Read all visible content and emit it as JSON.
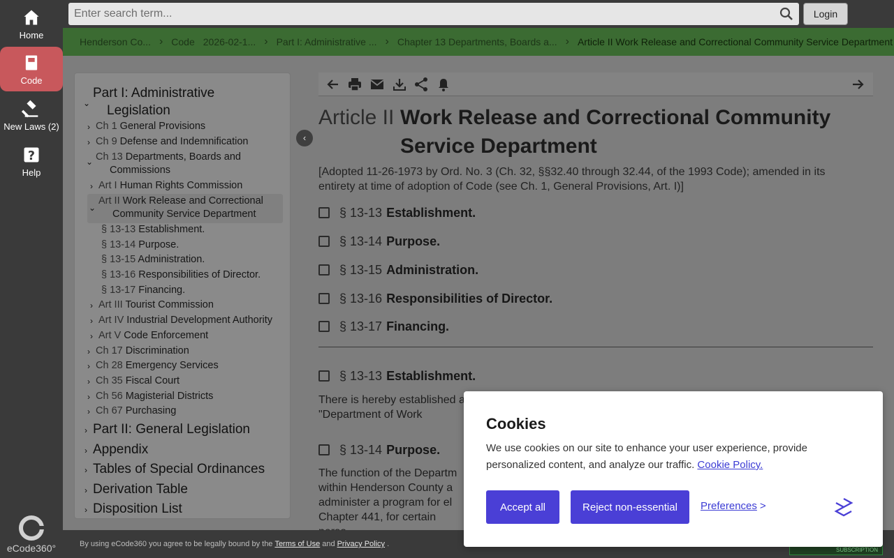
{
  "rail": {
    "items": [
      {
        "label": "Home",
        "icon": "home-icon"
      },
      {
        "label": "Code",
        "icon": "book-icon"
      },
      {
        "label": "New Laws (2)",
        "icon": "gavel-icon"
      },
      {
        "label": "Help",
        "icon": "help-icon"
      }
    ],
    "logo": "eCode360°"
  },
  "search": {
    "placeholder": "Enter search term...",
    "login_label": "Login"
  },
  "breadcrumb": [
    "Henderson Co...",
    "Code",
    "2026-02-1...",
    "Part I: Administrative ...",
    "Chapter 13 Departments, Boards a...",
    "Article II Work Release and Correctional Community Service Department"
  ],
  "toc": {
    "part1_a": "Part I: Administrative",
    "part1_b": "Legislation",
    "ch1": {
      "num": "Ch 1",
      "title": "General Provisions"
    },
    "ch9": {
      "num": "Ch 9",
      "title": "Defense and Indemnification"
    },
    "ch13": {
      "num": "Ch 13",
      "title_a": "Departments, Boards and",
      "title_b": "Commissions"
    },
    "art1": {
      "num": "Art I",
      "title": "Human Rights Commission"
    },
    "art2": {
      "num": "Art II",
      "title_a": "Work Release and Correctional",
      "title_b": "Community Service Department"
    },
    "s13": {
      "num": "§ 13-13",
      "title": "Establishment."
    },
    "s14": {
      "num": "§ 13-14",
      "title": "Purpose."
    },
    "s15": {
      "num": "§ 13-15",
      "title": "Administration."
    },
    "s16": {
      "num": "§ 13-16",
      "title": "Responsibilities of Director."
    },
    "s17": {
      "num": "§ 13-17",
      "title": "Financing."
    },
    "art3": {
      "num": "Art III",
      "title": "Tourist Commission"
    },
    "art4": {
      "num": "Art IV",
      "title": "Industrial Development Authority"
    },
    "art5": {
      "num": "Art V",
      "title": "Code Enforcement"
    },
    "ch17": {
      "num": "Ch 17",
      "title": "Discrimination"
    },
    "ch28": {
      "num": "Ch 28",
      "title": "Emergency Services"
    },
    "ch35": {
      "num": "Ch 35",
      "title": "Fiscal Court"
    },
    "ch56": {
      "num": "Ch 56",
      "title": "Magisterial Districts"
    },
    "ch67": {
      "num": "Ch 67",
      "title": "Purchasing"
    },
    "part2": "Part II: General Legislation",
    "appendix": "Appendix",
    "tables": "Tables of Special Ordinances",
    "derivation": "Derivation Table",
    "disposition": "Disposition List"
  },
  "content": {
    "article_label": "Article II",
    "article_title": "Work Release and Correctional Community Service Department",
    "history": "[Adopted 11-26-1973 by Ord. No. 3 (Ch. 32, §§32.40 through 32.44, of the 1993 Code); amended in its entirety at time of adoption of Code (see Ch. 1, General Provisions, Art. I)]",
    "sections": [
      {
        "num": "§ 13-13",
        "title": "Establishment."
      },
      {
        "num": "§ 13-14",
        "title": "Purpose."
      },
      {
        "num": "§ 13-15",
        "title": "Administration."
      },
      {
        "num": "§ 13-16",
        "title": "Responsibilities of Director."
      },
      {
        "num": "§ 13-17",
        "title": "Financing."
      }
    ],
    "sec1": {
      "num": "§ 13-13",
      "title": "Establishment.",
      "text": "There is hereby established a \"Department of Work Release"
    },
    "sec2": {
      "num": "§ 13-14",
      "title": "Purpose.",
      "text": "The function of the Departm within Henderson County a administer a program for el Chapter 441, for certain perso"
    }
  },
  "footer": {
    "prefix": "By using eCode360 you agree to be legally bound by the",
    "terms": "Terms of Use",
    "and": "and",
    "privacy": "Privacy Policy",
    "suffix": ".",
    "badge": "SUBSCRIPTION"
  },
  "cookie": {
    "title": "Cookies",
    "text": "We use cookies on our site to enhance your user experience, provide personalized content, and analyze our traffic.",
    "policy_link": "Cookie Policy.",
    "accept": "Accept all",
    "reject": "Reject non-essential",
    "preferences": "Preferences",
    "pref_arrow": ">"
  }
}
